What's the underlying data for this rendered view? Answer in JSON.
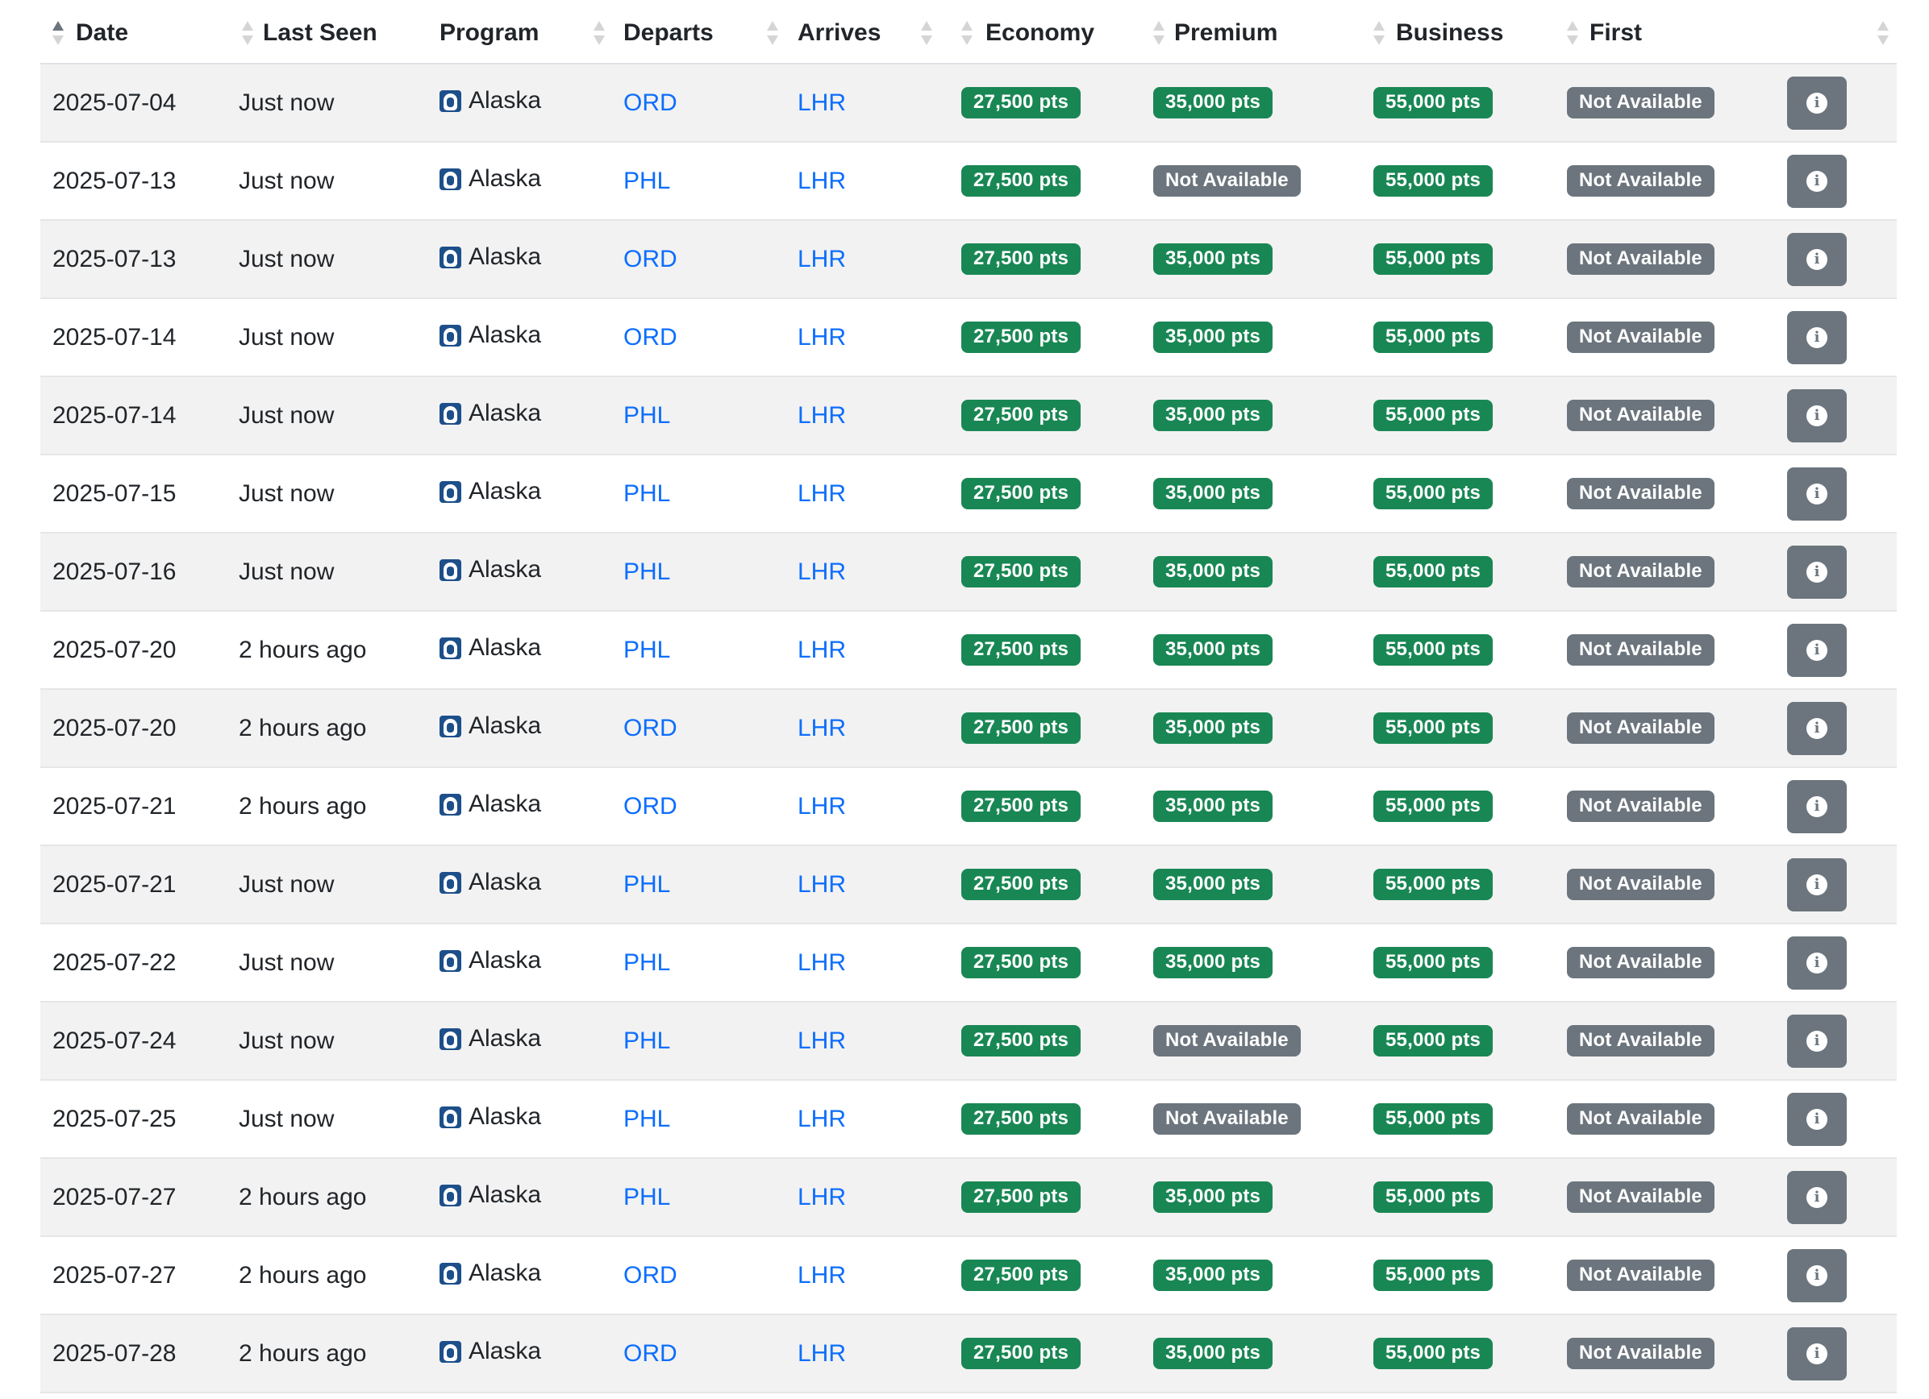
{
  "table": {
    "headers": {
      "date": "Date",
      "last_seen": "Last Seen",
      "program": "Program",
      "departs": "Departs",
      "arrives": "Arrives",
      "economy": "Economy",
      "premium": "Premium",
      "business": "Business",
      "first": "First"
    },
    "sort": {
      "column": "date",
      "direction": "ascending"
    },
    "colors": {
      "available_badge": "#198754",
      "not_available_badge": "#6c757d",
      "airport_link": "#0d6efd",
      "info_button": "#6c757d"
    },
    "program_icon": "alaska-logo-icon",
    "info_icon": "info-circle-icon",
    "rows": [
      {
        "date": "2025-07-04",
        "last_seen": "Just now",
        "program": "Alaska",
        "departs": "ORD",
        "arrives": "LHR",
        "economy": "27,500 pts",
        "premium": "35,000 pts",
        "business": "55,000 pts",
        "first": "Not Available"
      },
      {
        "date": "2025-07-13",
        "last_seen": "Just now",
        "program": "Alaska",
        "departs": "PHL",
        "arrives": "LHR",
        "economy": "27,500 pts",
        "premium": "Not Available",
        "business": "55,000 pts",
        "first": "Not Available"
      },
      {
        "date": "2025-07-13",
        "last_seen": "Just now",
        "program": "Alaska",
        "departs": "ORD",
        "arrives": "LHR",
        "economy": "27,500 pts",
        "premium": "35,000 pts",
        "business": "55,000 pts",
        "first": "Not Available"
      },
      {
        "date": "2025-07-14",
        "last_seen": "Just now",
        "program": "Alaska",
        "departs": "ORD",
        "arrives": "LHR",
        "economy": "27,500 pts",
        "premium": "35,000 pts",
        "business": "55,000 pts",
        "first": "Not Available"
      },
      {
        "date": "2025-07-14",
        "last_seen": "Just now",
        "program": "Alaska",
        "departs": "PHL",
        "arrives": "LHR",
        "economy": "27,500 pts",
        "premium": "35,000 pts",
        "business": "55,000 pts",
        "first": "Not Available"
      },
      {
        "date": "2025-07-15",
        "last_seen": "Just now",
        "program": "Alaska",
        "departs": "PHL",
        "arrives": "LHR",
        "economy": "27,500 pts",
        "premium": "35,000 pts",
        "business": "55,000 pts",
        "first": "Not Available"
      },
      {
        "date": "2025-07-16",
        "last_seen": "Just now",
        "program": "Alaska",
        "departs": "PHL",
        "arrives": "LHR",
        "economy": "27,500 pts",
        "premium": "35,000 pts",
        "business": "55,000 pts",
        "first": "Not Available"
      },
      {
        "date": "2025-07-20",
        "last_seen": "2 hours ago",
        "program": "Alaska",
        "departs": "PHL",
        "arrives": "LHR",
        "economy": "27,500 pts",
        "premium": "35,000 pts",
        "business": "55,000 pts",
        "first": "Not Available"
      },
      {
        "date": "2025-07-20",
        "last_seen": "2 hours ago",
        "program": "Alaska",
        "departs": "ORD",
        "arrives": "LHR",
        "economy": "27,500 pts",
        "premium": "35,000 pts",
        "business": "55,000 pts",
        "first": "Not Available"
      },
      {
        "date": "2025-07-21",
        "last_seen": "2 hours ago",
        "program": "Alaska",
        "departs": "ORD",
        "arrives": "LHR",
        "economy": "27,500 pts",
        "premium": "35,000 pts",
        "business": "55,000 pts",
        "first": "Not Available"
      },
      {
        "date": "2025-07-21",
        "last_seen": "Just now",
        "program": "Alaska",
        "departs": "PHL",
        "arrives": "LHR",
        "economy": "27,500 pts",
        "premium": "35,000 pts",
        "business": "55,000 pts",
        "first": "Not Available"
      },
      {
        "date": "2025-07-22",
        "last_seen": "Just now",
        "program": "Alaska",
        "departs": "PHL",
        "arrives": "LHR",
        "economy": "27,500 pts",
        "premium": "35,000 pts",
        "business": "55,000 pts",
        "first": "Not Available"
      },
      {
        "date": "2025-07-24",
        "last_seen": "Just now",
        "program": "Alaska",
        "departs": "PHL",
        "arrives": "LHR",
        "economy": "27,500 pts",
        "premium": "Not Available",
        "business": "55,000 pts",
        "first": "Not Available"
      },
      {
        "date": "2025-07-25",
        "last_seen": "Just now",
        "program": "Alaska",
        "departs": "PHL",
        "arrives": "LHR",
        "economy": "27,500 pts",
        "premium": "Not Available",
        "business": "55,000 pts",
        "first": "Not Available"
      },
      {
        "date": "2025-07-27",
        "last_seen": "2 hours ago",
        "program": "Alaska",
        "departs": "PHL",
        "arrives": "LHR",
        "economy": "27,500 pts",
        "premium": "35,000 pts",
        "business": "55,000 pts",
        "first": "Not Available"
      },
      {
        "date": "2025-07-27",
        "last_seen": "2 hours ago",
        "program": "Alaska",
        "departs": "ORD",
        "arrives": "LHR",
        "economy": "27,500 pts",
        "premium": "35,000 pts",
        "business": "55,000 pts",
        "first": "Not Available"
      },
      {
        "date": "2025-07-28",
        "last_seen": "2 hours ago",
        "program": "Alaska",
        "departs": "ORD",
        "arrives": "LHR",
        "economy": "27,500 pts",
        "premium": "35,000 pts",
        "business": "55,000 pts",
        "first": "Not Available"
      }
    ]
  }
}
